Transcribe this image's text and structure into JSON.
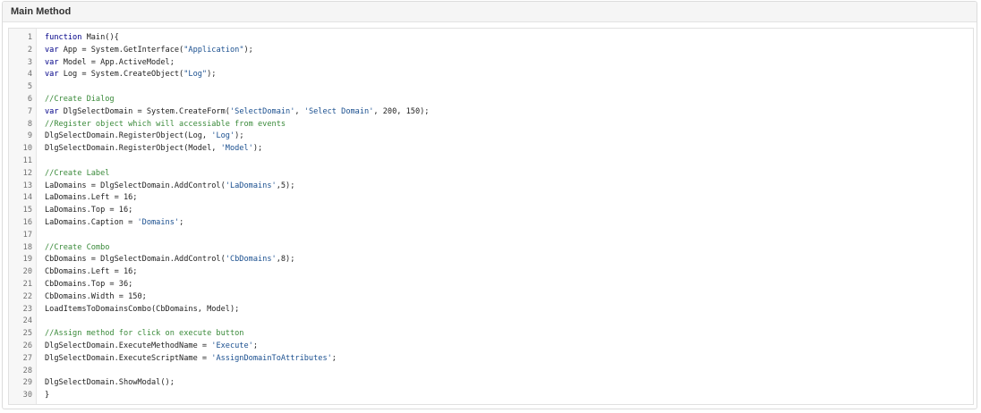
{
  "panel": {
    "title": "Main Method"
  },
  "code": {
    "lines": [
      [
        {
          "t": "function",
          "c": "kw"
        },
        {
          "t": " Main(){"
        }
      ],
      [
        {
          "t": "var",
          "c": "kw"
        },
        {
          "t": " App = System.GetInterface("
        },
        {
          "t": "\"Application\"",
          "c": "str"
        },
        {
          "t": ");"
        }
      ],
      [
        {
          "t": "var",
          "c": "kw"
        },
        {
          "t": " Model = App.ActiveModel;"
        }
      ],
      [
        {
          "t": "var",
          "c": "kw"
        },
        {
          "t": " Log = System.CreateObject("
        },
        {
          "t": "\"Log\"",
          "c": "str"
        },
        {
          "t": ");"
        }
      ],
      [],
      [
        {
          "t": "//Create Dialog",
          "c": "cm"
        }
      ],
      [
        {
          "t": "var",
          "c": "kw"
        },
        {
          "t": " DlgSelectDomain = System.CreateForm("
        },
        {
          "t": "'SelectDomain'",
          "c": "str"
        },
        {
          "t": ", "
        },
        {
          "t": "'Select Domain'",
          "c": "str"
        },
        {
          "t": ", 200, 150);"
        }
      ],
      [
        {
          "t": "//Register object which will accessiable from events",
          "c": "cm"
        }
      ],
      [
        {
          "t": "DlgSelectDomain.RegisterObject(Log, "
        },
        {
          "t": "'Log'",
          "c": "str"
        },
        {
          "t": ");"
        }
      ],
      [
        {
          "t": "DlgSelectDomain.RegisterObject(Model, "
        },
        {
          "t": "'Model'",
          "c": "str"
        },
        {
          "t": ");"
        }
      ],
      [],
      [
        {
          "t": "//Create Label",
          "c": "cm"
        }
      ],
      [
        {
          "t": "LaDomains = DlgSelectDomain.AddControl("
        },
        {
          "t": "'LaDomains'",
          "c": "str"
        },
        {
          "t": ",5);"
        }
      ],
      [
        {
          "t": "LaDomains.Left = 16;"
        }
      ],
      [
        {
          "t": "LaDomains.Top = 16;"
        }
      ],
      [
        {
          "t": "LaDomains.Caption = "
        },
        {
          "t": "'Domains'",
          "c": "str"
        },
        {
          "t": ";"
        }
      ],
      [],
      [
        {
          "t": "//Create Combo",
          "c": "cm"
        }
      ],
      [
        {
          "t": "CbDomains = DlgSelectDomain.AddControl("
        },
        {
          "t": "'CbDomains'",
          "c": "str"
        },
        {
          "t": ",8);"
        }
      ],
      [
        {
          "t": "CbDomains.Left = 16;"
        }
      ],
      [
        {
          "t": "CbDomains.Top = 36;"
        }
      ],
      [
        {
          "t": "CbDomains.Width = 150;"
        }
      ],
      [
        {
          "t": "LoadItemsToDomainsCombo(CbDomains, Model);"
        }
      ],
      [],
      [
        {
          "t": "//Assign method for click on execute button",
          "c": "cm"
        }
      ],
      [
        {
          "t": "DlgSelectDomain.ExecuteMethodName = "
        },
        {
          "t": "'Execute'",
          "c": "str"
        },
        {
          "t": ";"
        }
      ],
      [
        {
          "t": "DlgSelectDomain.ExecuteScriptName = "
        },
        {
          "t": "'AssignDomainToAttributes'",
          "c": "str"
        },
        {
          "t": ";"
        }
      ],
      [],
      [
        {
          "t": "DlgSelectDomain.ShowModal();"
        }
      ],
      [
        {
          "t": "}"
        }
      ]
    ]
  }
}
